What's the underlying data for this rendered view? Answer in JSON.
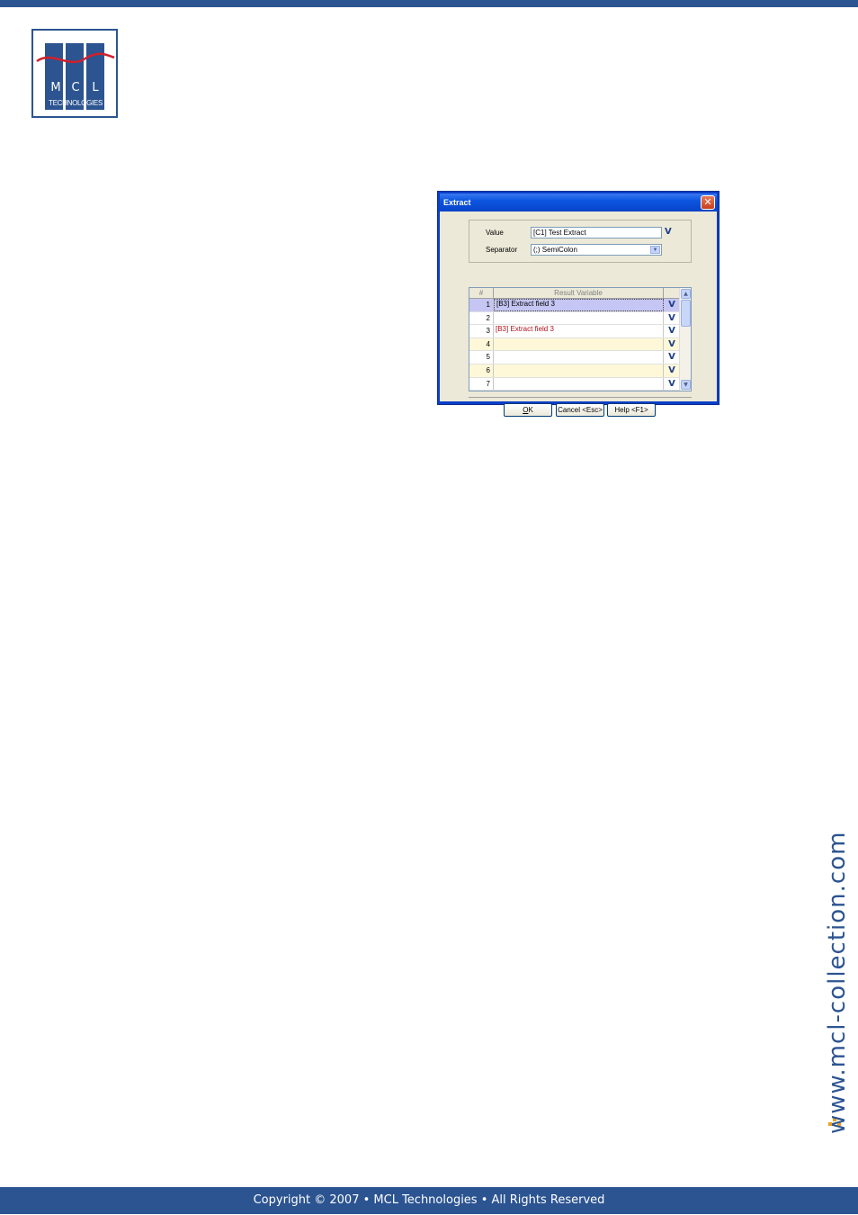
{
  "logo": {
    "letters": [
      "M",
      "C",
      "L"
    ],
    "subtitle": "TECHNOLOGIES",
    "colors": {
      "blue": "#2c5491",
      "red": "#d0202a"
    }
  },
  "dialog": {
    "title": "Extract",
    "close_glyph": "✕",
    "value_label": "Value",
    "value_text": "[C1] Test Extract",
    "separator_label": "Separator",
    "separator_text": "(;) SemiColon",
    "check_glyph": "V",
    "grid": {
      "headers": {
        "num": "#",
        "var": "Result Variable"
      },
      "rows": [
        {
          "num": "1",
          "var": "[B3] Extract field 3",
          "check": "V",
          "state": "selected"
        },
        {
          "num": "2",
          "var": "",
          "check": "V",
          "state": "normal"
        },
        {
          "num": "3",
          "var": "[B3] Extract field 3",
          "check": "V",
          "state": "red"
        },
        {
          "num": "4",
          "var": "",
          "check": "V",
          "state": "alt"
        },
        {
          "num": "5",
          "var": "",
          "check": "V",
          "state": "normal"
        },
        {
          "num": "6",
          "var": "",
          "check": "V",
          "state": "alt"
        },
        {
          "num": "7",
          "var": "",
          "check": "V",
          "state": "normal"
        }
      ]
    },
    "buttons": {
      "ok_underlined": "O",
      "ok_rest": "K",
      "cancel": "Cancel <Esc>",
      "help": "Help <F1>"
    }
  },
  "side_url": "www.mcl-collection.com",
  "footer": "Copyright © 2007 • MCL Technologies • All Rights Reserved"
}
